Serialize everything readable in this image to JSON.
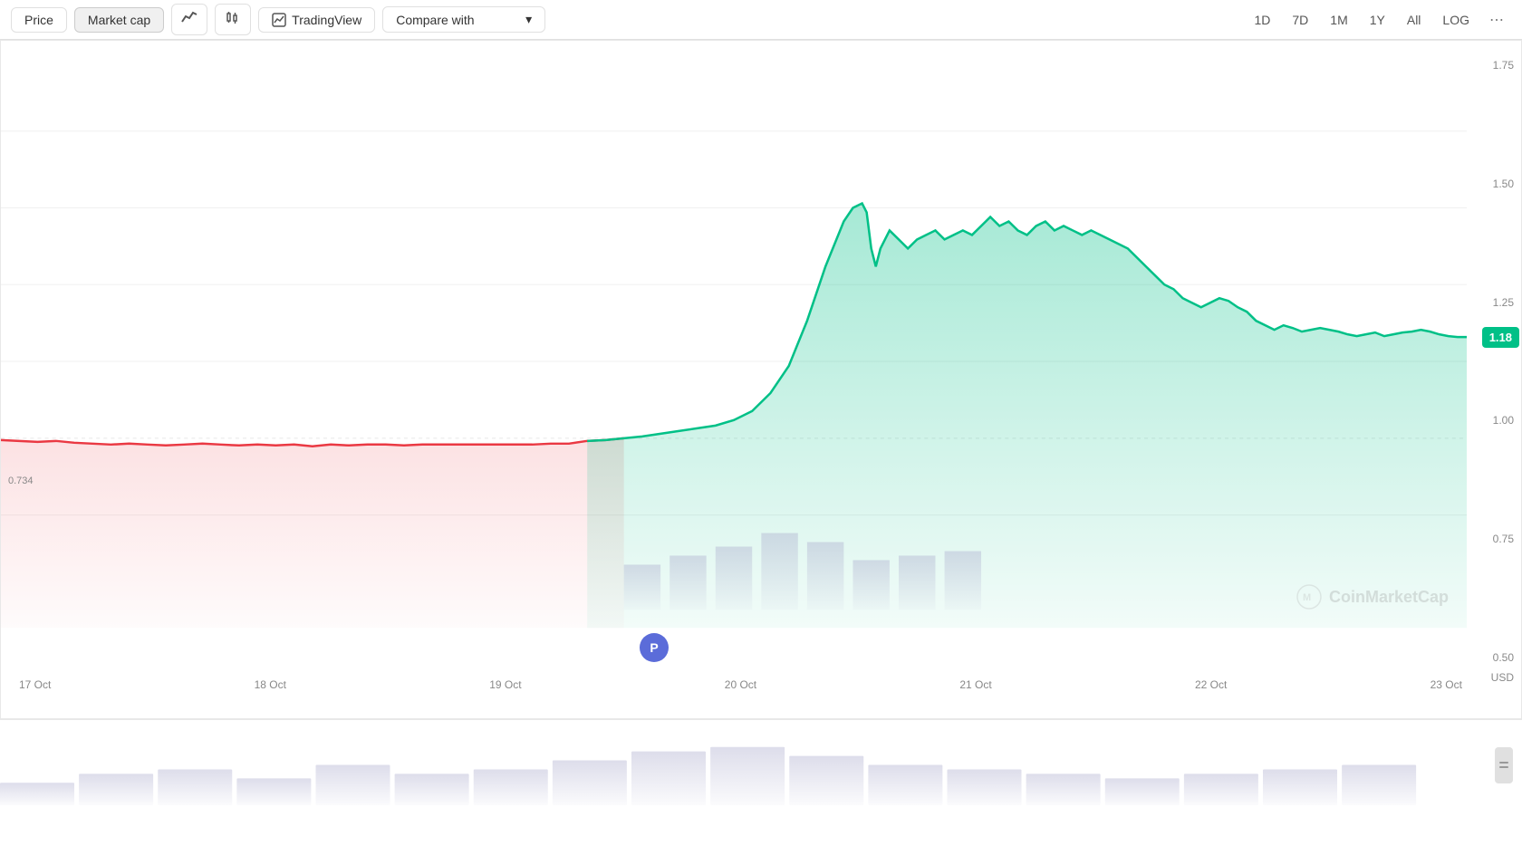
{
  "toolbar": {
    "price_label": "Price",
    "market_cap_label": "Market cap",
    "line_icon": "〜",
    "candle_icon": "⊞",
    "tradingview_label": "TradingView",
    "compare_label": "Compare with",
    "timeframes": [
      "1D",
      "7D",
      "1M",
      "1Y",
      "All",
      "LOG"
    ],
    "more_icon": "⋯"
  },
  "chart": {
    "y_labels": [
      "1.75",
      "1.50",
      "1.25",
      "1.00",
      "0.75",
      "0.50"
    ],
    "x_labels": [
      "17 Oct",
      "18 Oct",
      "19 Oct",
      "20 Oct",
      "21 Oct",
      "22 Oct",
      "23 Oct"
    ],
    "current_price": "1.18",
    "start_price": "0.734",
    "currency": "USD",
    "watermark": "CoinMarketCap"
  },
  "nav_pin": {
    "label": "P"
  },
  "scroll": {
    "icon": "⏸"
  }
}
